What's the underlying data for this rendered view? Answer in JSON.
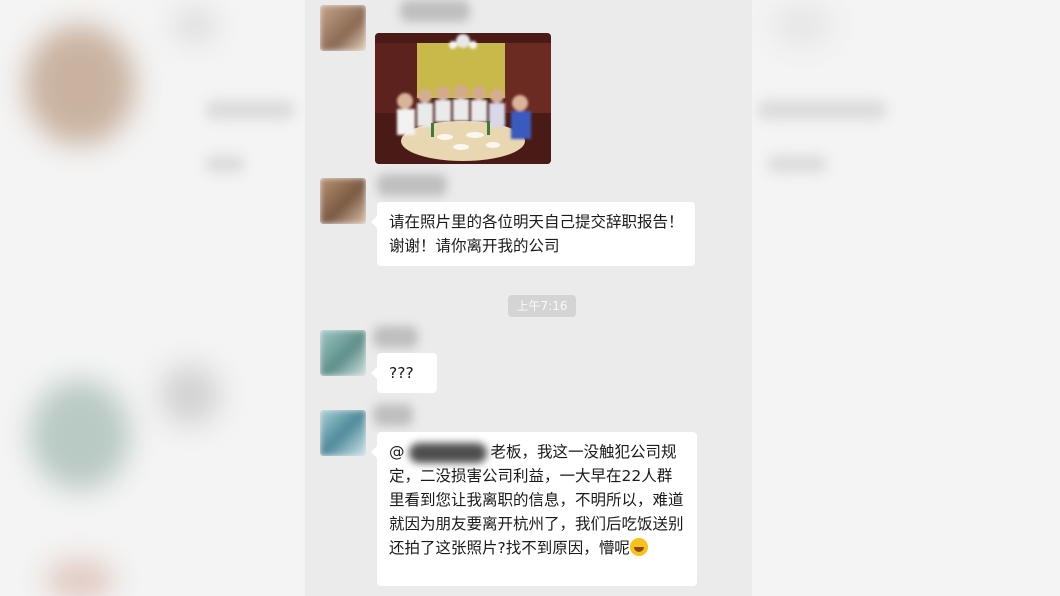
{
  "chat": {
    "message_1": "请在照片里的各位明天自己提交辞职报告！谢谢！请你离开我的公司",
    "timestamp": "上午7:16",
    "message_2": "???",
    "message_3_prefix": "@",
    "message_3_body": "老板，我这一没触犯公司规定，二没损害公司利益，一大早在22人群里看到您让我离职的信息，不明所以，难道就因为朋友要离开杭州了，我们后吃饭送别还拍了这张照片?找不到原因，懵呢"
  },
  "colors": {
    "chat_background": "#ebebeb",
    "bubble": "#ffffff",
    "timestamp_pill": "#d4d4d4"
  }
}
